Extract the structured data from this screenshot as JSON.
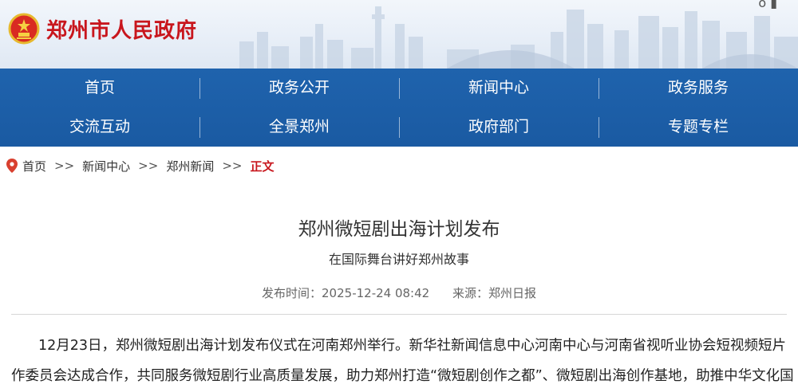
{
  "header": {
    "site_name": "郑州市人民政府",
    "emblem_icon": "national-emblem-icon",
    "brand_color": "#c8161d"
  },
  "nav": {
    "color": "#1d5fa8",
    "row1": [
      "首页",
      "政务公开",
      "新闻中心",
      "政务服务"
    ],
    "row2": [
      "交流互动",
      "全景郑州",
      "政府部门",
      "专题专栏"
    ]
  },
  "breadcrumb": {
    "icon": "location-pin-icon",
    "items": [
      "首页",
      "新闻中心",
      "郑州新闻"
    ],
    "separator": ">>",
    "current": "正文"
  },
  "article": {
    "title": "郑州微短剧出海计划发布",
    "subtitle": "在国际舞台讲好郑州故事",
    "publish_label": "发布时间：2025-12-24 08:42",
    "source_label": "来源：郑州日报",
    "paragraph_line1": "12月23日，郑州微短剧出海计划发布仪式在河南郑州举行。新华社新闻信息中心河南中心与河南省视听业协会短视频短片",
    "paragraph_line2": "作委员会达成合作，共同服务微短剧行业高质量发展，助力郑州打造“微短剧创作之都”、微短剧出海创作基地，助推中华文化国"
  }
}
